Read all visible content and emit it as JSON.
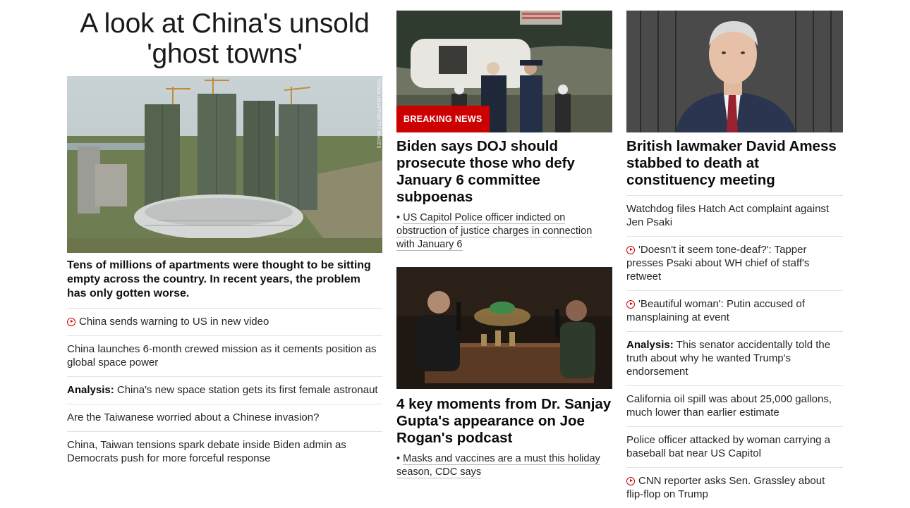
{
  "left": {
    "headline": "A look at China's unsold 'ghost towns'",
    "image_credit": "VIVIAN LIN/AFP/GETTY IMAGES",
    "description": "Tens of millions of apartments were thought to be sitting empty across the country. In recent years, the problem has only gotten worse.",
    "items": [
      {
        "video": true,
        "prefix": "",
        "text": "China sends warning to US in new video"
      },
      {
        "video": false,
        "prefix": "",
        "text": "China launches 6-month crewed mission as it cements position as global space power"
      },
      {
        "video": false,
        "prefix": "Analysis:",
        "text": " China's new space station gets its first female astronaut"
      },
      {
        "video": false,
        "prefix": "",
        "text": "Are the Taiwanese worried about a Chinese invasion?"
      },
      {
        "video": false,
        "prefix": "",
        "text": "China, Taiwan tensions spark debate inside Biden admin as Democrats push for more forceful response"
      }
    ]
  },
  "middle": {
    "card1": {
      "badge": "BREAKING NEWS",
      "title": "Biden says DOJ should prosecute those who defy January 6 committee subpoenas",
      "sub_text": "US Capitol Police officer indicted on obstruction of justice charges in connection with January 6"
    },
    "card2": {
      "title": "4 key moments from Dr. Sanjay Gupta's appearance on Joe Rogan's podcast",
      "sub_text": "Masks and vaccines are a must this holiday season, CDC says"
    }
  },
  "right": {
    "title": "British lawmaker David Amess stabbed to death at constituency meeting",
    "items": [
      {
        "video": false,
        "prefix": "",
        "text": "Watchdog files Hatch Act complaint against Jen Psaki"
      },
      {
        "video": true,
        "prefix": "",
        "text": "'Doesn't it seem tone-deaf?': Tapper presses Psaki about WH chief of staff's retweet"
      },
      {
        "video": true,
        "prefix": "",
        "text": "'Beautiful woman': Putin accused of mansplaining at event"
      },
      {
        "video": false,
        "prefix": "Analysis:",
        "text": " This senator accidentally told the truth about why he wanted Trump's endorsement"
      },
      {
        "video": false,
        "prefix": "",
        "text": "California oil spill was about 25,000 gallons, much lower than earlier estimate"
      },
      {
        "video": false,
        "prefix": "",
        "text": "Police officer attacked by woman carrying a baseball bat near US Capitol"
      },
      {
        "video": true,
        "prefix": "",
        "text": "CNN reporter asks Sen. Grassley about flip-flop on Trump"
      }
    ]
  },
  "colors": {
    "accent": "#cc0000",
    "text": "#0c0c0c",
    "divider": "#e2e2e2"
  }
}
